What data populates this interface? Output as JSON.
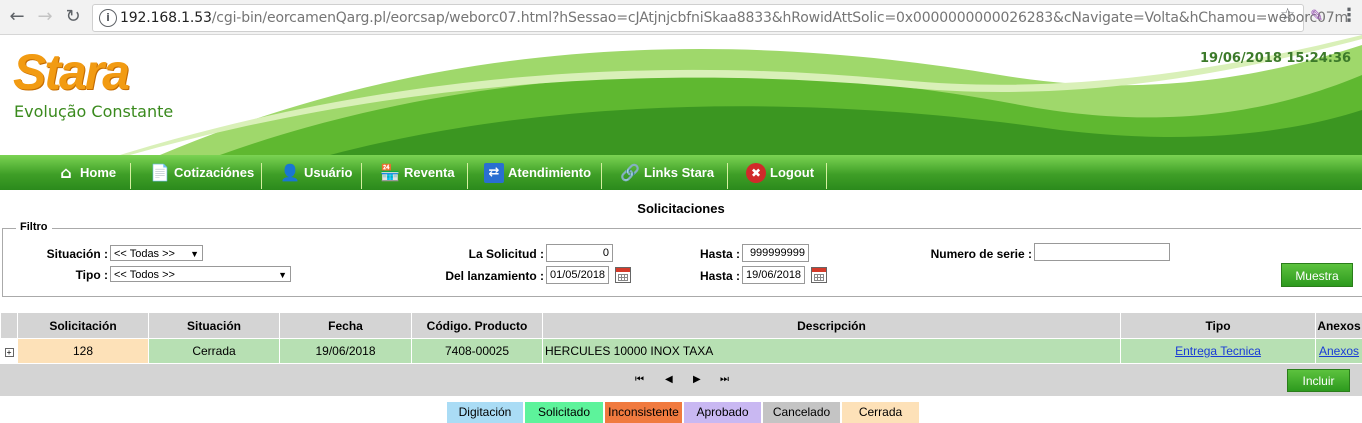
{
  "browser": {
    "back_icon": "←",
    "forward_icon": "→",
    "reload_icon": "↻",
    "url_host": "192.168.1.53",
    "url_path": "/cgi-bin/eorcamenQarg.pl/eorcsap/weborc07.html?hSessao=cJAtjnjcbfniSkaa8833&hRowidAttSolic=0x0000000000026283&cNavigate=Volta&hChamou=weborc07m"
  },
  "header": {
    "logo": "Stara",
    "tagline": "Evolução Constante",
    "datetime": "19/06/2018 15:24:36"
  },
  "nav": {
    "items": [
      {
        "label": "Home",
        "icon": "⌂"
      },
      {
        "label": "Cotizaciónes",
        "icon": "📄"
      },
      {
        "label": "Usuário",
        "icon": "👤"
      },
      {
        "label": "Reventa",
        "icon": "🏪"
      },
      {
        "label": "Atendimiento",
        "icon": "⇄"
      },
      {
        "label": "Links Stara",
        "icon": "🔗"
      },
      {
        "label": "Logout",
        "icon": "✖"
      }
    ]
  },
  "page": {
    "title": "Solicitaciones"
  },
  "filter": {
    "legend": "Filtro",
    "situacion_label": "Situación :",
    "situacion_value": "<< Todas >>",
    "tipo_label": "Tipo :",
    "tipo_value": "<< Todos >>",
    "solicitud_label": "La Solicitud :",
    "solicitud_from": "0",
    "hasta1_label": "Hasta :",
    "solicitud_to": "999999999",
    "lanzamiento_label": "Del lanzamiento :",
    "date_from": "01/05/2018",
    "hasta2_label": "Hasta :",
    "date_to": "19/06/2018",
    "serie_label": "Numero de serie :",
    "serie_value": "",
    "search_button": "Muestra"
  },
  "table": {
    "columns": [
      "Solicitación",
      "Situación",
      "Fecha",
      "Código. Producto",
      "Descripción",
      "Tipo",
      "Anexos"
    ],
    "rows": [
      {
        "expand": "+",
        "solicitacion": "128",
        "situacion": "Cerrada",
        "fecha": "19/06/2018",
        "codigo": "7408-00025",
        "descripcion": "HERCULES 10000 INOX TAXA",
        "tipo": "Entrega Tecnica",
        "anexos": "Anexos"
      }
    ]
  },
  "pager": {
    "first": "⏮",
    "prev": "◀",
    "next": "▶",
    "last": "⏭"
  },
  "include_button": "Incluir",
  "legend": {
    "items": [
      {
        "label": "Digitación",
        "color": "#aadcf5"
      },
      {
        "label": "Solicitado",
        "color": "#5df39b"
      },
      {
        "label": "Inconsistente",
        "color": "#f07a3f"
      },
      {
        "label": "Aprobado",
        "color": "#c9b8f2"
      },
      {
        "label": "Cancelado",
        "color": "#c4c4c4"
      },
      {
        "label": "Cerrada",
        "color": "#fde1b8"
      }
    ]
  }
}
